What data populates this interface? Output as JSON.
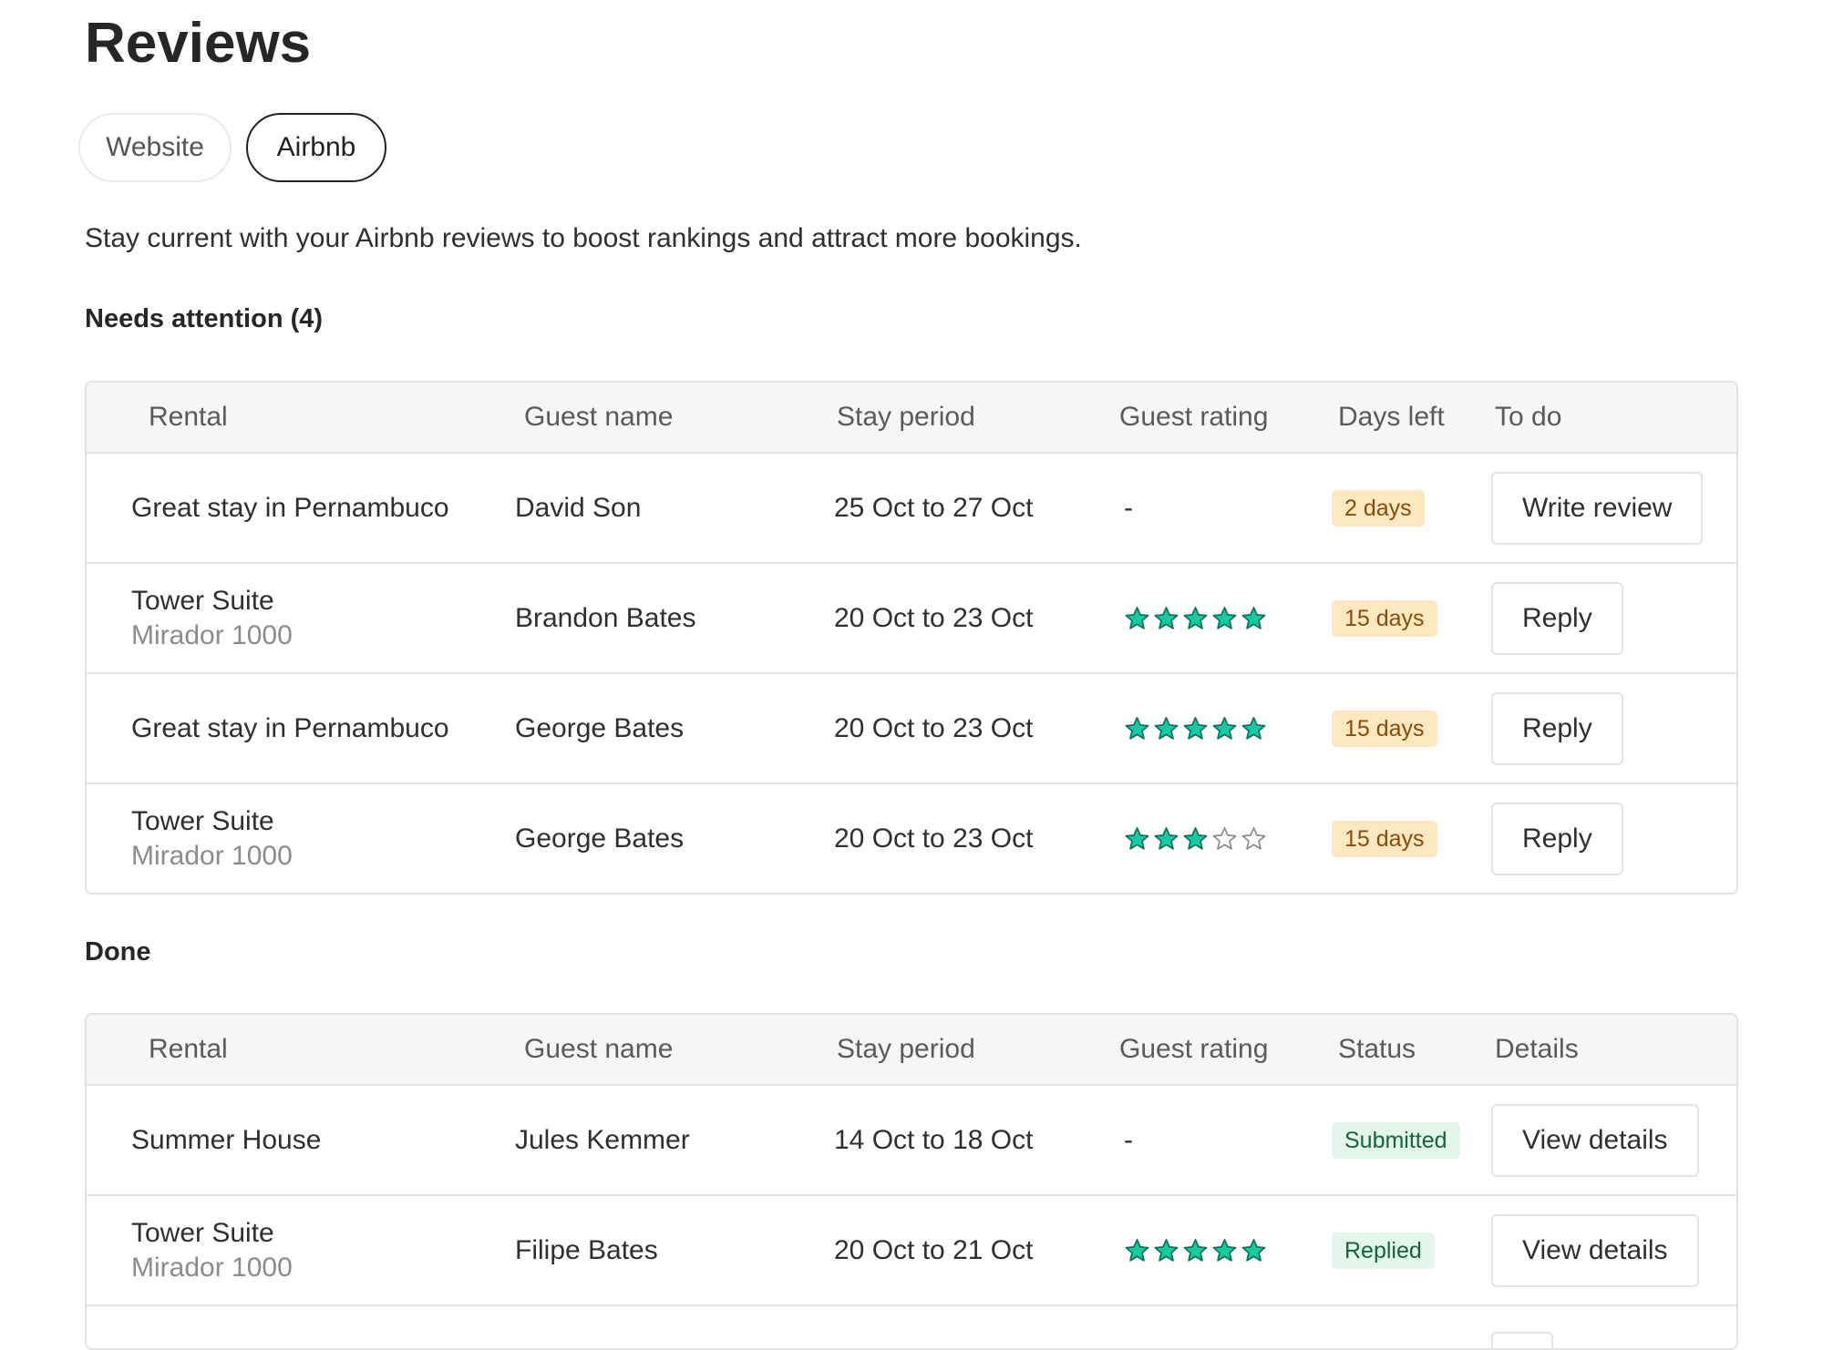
{
  "page": {
    "title": "Reviews"
  },
  "tabs": [
    {
      "label": "Website",
      "active": false
    },
    {
      "label": "Airbnb",
      "active": true
    }
  ],
  "intro": "Stay current with your Airbnb reviews to boost rankings and attract more bookings.",
  "colors": {
    "star": "#17c9a3",
    "star_outline": "#8a8a8a",
    "badge_warn_bg": "#fde8c2",
    "badge_ok_bg": "#e3f6ec"
  },
  "needs_attention": {
    "heading": "Needs attention (4)",
    "columns": [
      "Rental",
      "Guest name",
      "Stay period",
      "Guest rating",
      "Days left",
      "To do"
    ],
    "rows": [
      {
        "rental": "Great stay in Pernambuco",
        "rental_sub": "",
        "guest": "David Son",
        "stay": "25 Oct to 27 Oct",
        "rating": null,
        "rating_text": "-",
        "badge": "2 days",
        "action": "Write review"
      },
      {
        "rental": "Tower Suite",
        "rental_sub": "Mirador 1000",
        "guest": "Brandon Bates",
        "stay": "20 Oct to 23 Oct",
        "rating": 5,
        "rating_text": "",
        "badge": "15 days",
        "action": "Reply"
      },
      {
        "rental": "Great stay in Pernambuco",
        "rental_sub": "",
        "guest": "George Bates",
        "stay": "20 Oct to 23 Oct",
        "rating": 5,
        "rating_text": "",
        "badge": "15 days",
        "action": "Reply"
      },
      {
        "rental": "Tower Suite",
        "rental_sub": "Mirador 1000",
        "guest": "George Bates",
        "stay": "20 Oct to 23 Oct",
        "rating": 3,
        "rating_text": "",
        "badge": "15 days",
        "action": "Reply"
      }
    ]
  },
  "done": {
    "heading": "Done",
    "columns": [
      "Rental",
      "Guest name",
      "Stay period",
      "Guest rating",
      "Status",
      "Details"
    ],
    "rows": [
      {
        "rental": "Summer House",
        "rental_sub": "",
        "guest": "Jules Kemmer",
        "stay": "14 Oct to 18 Oct",
        "rating": null,
        "rating_text": "-",
        "badge": "Submitted",
        "action": "View details"
      },
      {
        "rental": "Tower Suite",
        "rental_sub": "Mirador 1000",
        "guest": "Filipe Bates",
        "stay": "20 Oct to 21 Oct",
        "rating": 5,
        "rating_text": "",
        "badge": "Replied",
        "action": "View details"
      }
    ]
  }
}
